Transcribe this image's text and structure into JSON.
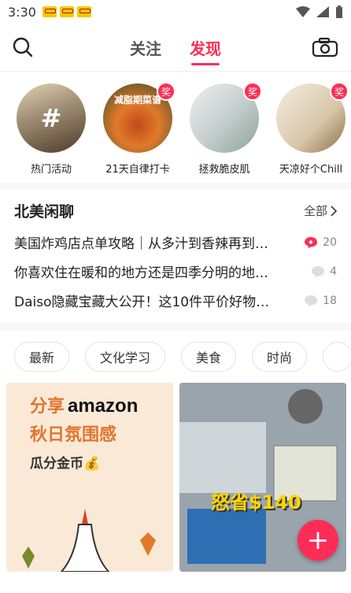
{
  "status_bar": {
    "time": "3:30"
  },
  "header": {
    "tabs": [
      {
        "label": "关注",
        "active": false
      },
      {
        "label": "发现",
        "active": true
      }
    ]
  },
  "stories": [
    {
      "label": "热门活动",
      "badge": ""
    },
    {
      "label": "21天自律打卡",
      "badge": "奖",
      "image_caption": "减脂期菜谱"
    },
    {
      "label": "拯救脆皮肌",
      "badge": "奖"
    },
    {
      "label": "天凉好个Chill",
      "badge": "奖"
    }
  ],
  "forum": {
    "title": "北美闲聊",
    "all_label": "全部",
    "posts": [
      {
        "title": "美国炸鸡店点单攻略｜从多汁到香辣再到…",
        "count": "20",
        "hot": true
      },
      {
        "title": "你喜欢住在暖和的地方还是四季分明的地…",
        "count": "4",
        "hot": false
      },
      {
        "title": "Daiso隐藏宝藏大公开！这10件平价好物…",
        "count": "18",
        "hot": false
      }
    ]
  },
  "chips": [
    "最新",
    "文化学习",
    "美食",
    "时尚",
    ""
  ],
  "feed": {
    "left": {
      "line1_prefix": "分享",
      "line1_logo": "amazon",
      "line2": "秋日氛围感",
      "line3": "瓜分金币💰"
    },
    "right": {
      "savings": "怒省$140"
    }
  },
  "fab_label": "+",
  "colors": {
    "accent": "#ff2d55"
  }
}
